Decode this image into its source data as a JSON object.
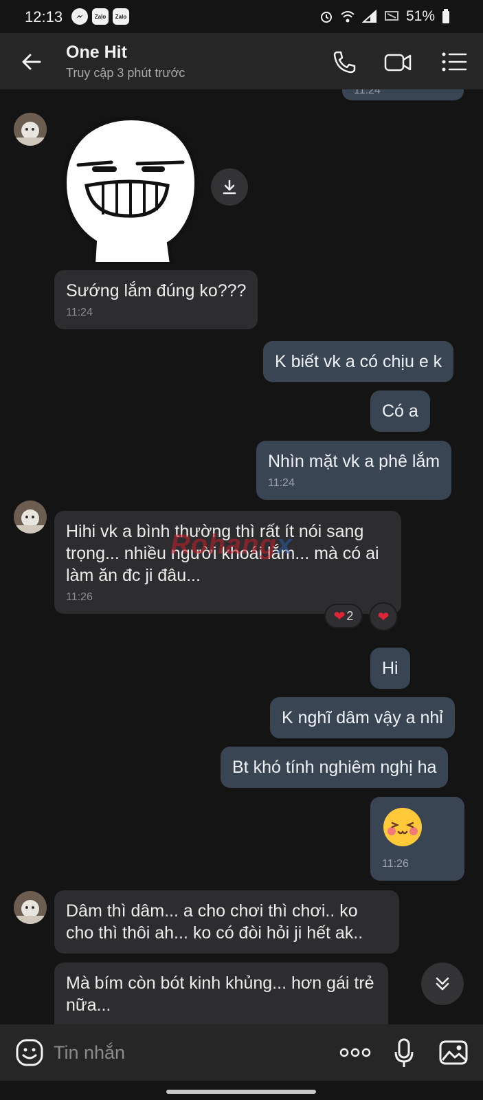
{
  "status_bar": {
    "time": "12:13",
    "apps": [
      "messenger-icon",
      "Zalo",
      "Zalo"
    ],
    "battery": "51%"
  },
  "header": {
    "title": "One Hit",
    "subtitle": "Truy cập 3 phút trước",
    "icons": [
      "back-arrow-icon",
      "phone-icon",
      "video-call-icon",
      "menu-icon"
    ]
  },
  "messages": [
    {
      "dir": "out",
      "text": "",
      "time": "11:24"
    },
    {
      "dir": "in",
      "type": "sticker",
      "sticker": "grinning-face-sticker"
    },
    {
      "dir": "in",
      "text": "Sướng lắm đúng ko???",
      "time": "11:24"
    },
    {
      "dir": "out",
      "text": "K biết vk a có chịu e k"
    },
    {
      "dir": "out",
      "text": "Có a"
    },
    {
      "dir": "out",
      "text": "Nhìn mặt vk a phê lắm",
      "time": "11:24"
    },
    {
      "dir": "in",
      "text": "Hihi vk a bình thường thì rất ít nói sang trọng... nhiều người khoái lắm... mà có ai làm ăn đc ji đâu...",
      "time": "11:26",
      "reaction_count": "2"
    },
    {
      "dir": "out",
      "text": "Hi"
    },
    {
      "dir": "out",
      "text": "K nghĩ dâm vậy a nhỉ"
    },
    {
      "dir": "out",
      "text": "Bt khó tính nghiêm nghị ha"
    },
    {
      "dir": "out",
      "type": "emoji",
      "emoji": "blushing-face-emoji",
      "time": "11:26"
    },
    {
      "dir": "in",
      "text": "Dâm thì dâm... a cho chơi thì chơi.. ko cho thì thôi ah... ko có đòi hỏi ji hết ak.."
    },
    {
      "dir": "in",
      "text": "Mà bím còn bót kinh khủng... hơn gái trẻ nữa..."
    }
  ],
  "watermark": {
    "part1": "Rohang",
    "part2": "x"
  },
  "input": {
    "placeholder": "Tin nhắn"
  },
  "colors": {
    "bg": "#141414",
    "bar": "#262626",
    "incoming": "#2d2d2f",
    "outgoing": "#3a4553"
  }
}
